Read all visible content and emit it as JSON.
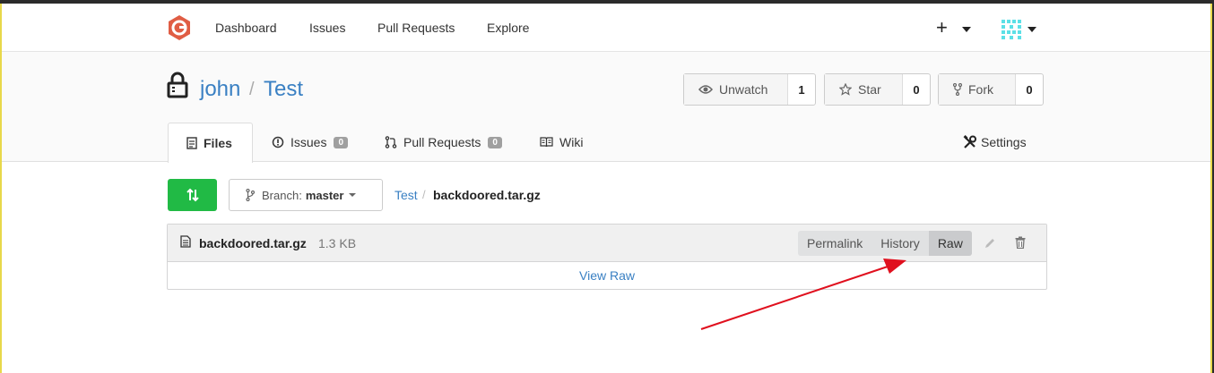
{
  "nav": {
    "items": [
      "Dashboard",
      "Issues",
      "Pull Requests",
      "Explore"
    ],
    "plus_icon": "plus-icon",
    "avatar_icon": "avatar-identicon"
  },
  "repo": {
    "owner": "john",
    "separator": "/",
    "name": "Test",
    "lock_icon": "lock-icon",
    "actions": {
      "watch": {
        "label": "Unwatch",
        "count": "1",
        "icon": "eye-icon"
      },
      "star": {
        "label": "Star",
        "count": "0",
        "icon": "star-icon"
      },
      "fork": {
        "label": "Fork",
        "count": "0",
        "icon": "fork-icon"
      }
    }
  },
  "tabs": [
    {
      "label": "Files",
      "icon": "file-text-icon",
      "active": true
    },
    {
      "label": "Issues",
      "icon": "issue-opened-icon",
      "badge": "0"
    },
    {
      "label": "Pull Requests",
      "icon": "pull-request-icon",
      "badge": "0"
    },
    {
      "label": "Wiki",
      "icon": "book-icon"
    },
    {
      "label": "Settings",
      "icon": "tools-icon"
    }
  ],
  "branch": {
    "label": "Branch:",
    "name": "master",
    "compare_icon": "compare-icon",
    "breadcrumb_repo": "Test",
    "breadcrumb_sep": "/",
    "breadcrumb_file": "backdoored.tar.gz"
  },
  "file": {
    "name": "backdoored.tar.gz",
    "size": "1.3 KB",
    "actions": [
      "Permalink",
      "History",
      "Raw"
    ],
    "view_raw": "View Raw"
  },
  "colors": {
    "link": "#3a80c3",
    "compare_button": "#21ba45",
    "annotation_arrow": "#e0101e"
  }
}
